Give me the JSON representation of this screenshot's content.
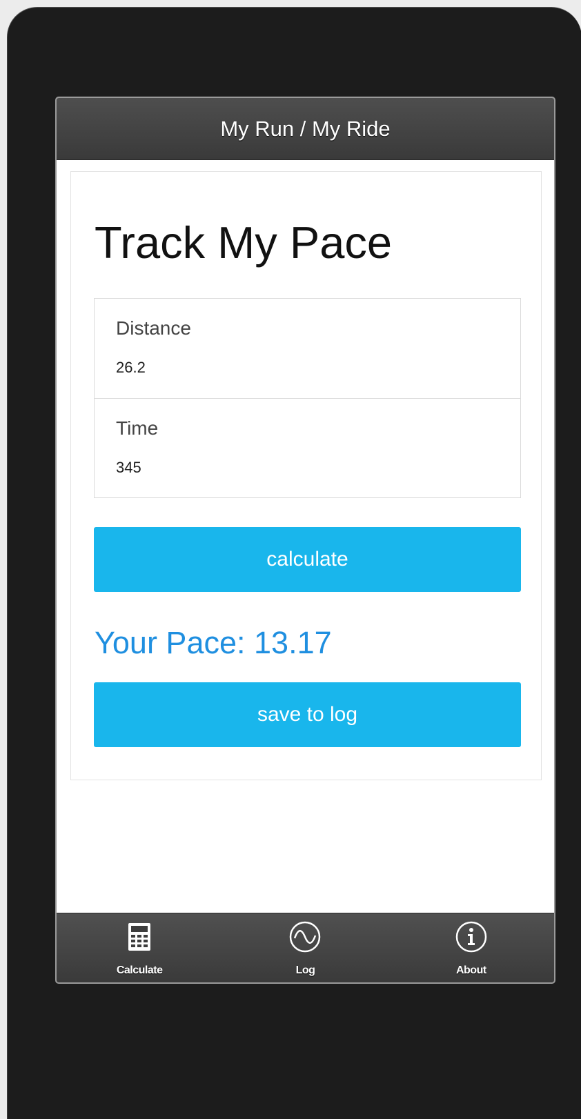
{
  "header": {
    "title": "My Run / My Ride"
  },
  "main": {
    "title": "Track My Pace",
    "fields": {
      "distance": {
        "label": "Distance",
        "value": "26.2"
      },
      "time": {
        "label": "Time",
        "value": "345"
      }
    },
    "calculate_label": "calculate",
    "pace": {
      "label": "Your Pace:",
      "value": "13.17"
    },
    "save_label": "save to log"
  },
  "tabbar": {
    "items": [
      {
        "label": "Calculate",
        "icon": "calculator-icon"
      },
      {
        "label": "Log",
        "icon": "wave-icon"
      },
      {
        "label": "About",
        "icon": "info-icon"
      }
    ]
  },
  "colors": {
    "accent": "#19b6ec",
    "pace_text": "#1f8fe0",
    "bar": "#454545"
  }
}
